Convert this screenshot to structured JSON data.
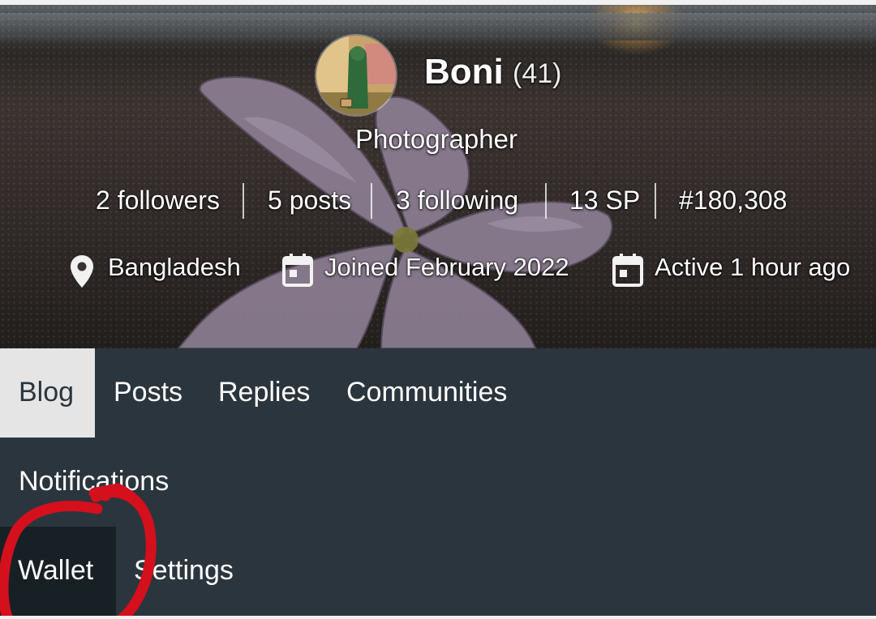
{
  "profile": {
    "name": "Boni",
    "reputation": "(41)",
    "about": "Photographer",
    "stats": {
      "followers": "2 followers",
      "posts": "5 posts",
      "following": "3 following",
      "sp": "13 SP",
      "rank": "#180,308"
    },
    "location": "Bangladesh",
    "joined": "Joined February 2022",
    "active": "Active 1 hour ago"
  },
  "tabs": {
    "blog": "Blog",
    "posts": "Posts",
    "replies": "Replies",
    "communities": "Communities",
    "notifications": "Notifications",
    "wallet": "Wallet",
    "settings": "Settings"
  },
  "colors": {
    "nav_background": "#2b353d",
    "active_tab": "#e5e5e5",
    "wallet_highlight": "#172025",
    "annotation_red": "#d3101c"
  },
  "icons": {
    "location": "location-pin-icon",
    "joined": "calendar-icon",
    "active": "calendar-icon"
  }
}
